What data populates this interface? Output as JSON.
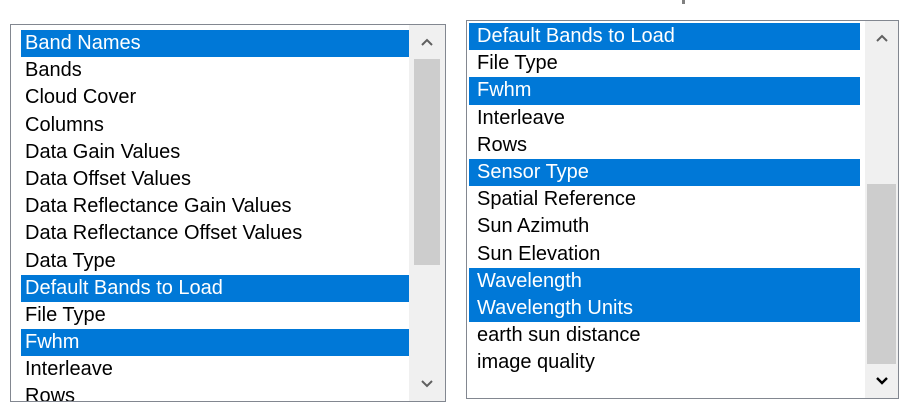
{
  "left_list": {
    "items": [
      {
        "label": "Band Names",
        "selected": true
      },
      {
        "label": "Bands",
        "selected": false
      },
      {
        "label": "Cloud Cover",
        "selected": false
      },
      {
        "label": "Columns",
        "selected": false
      },
      {
        "label": "Data Gain Values",
        "selected": false
      },
      {
        "label": "Data Offset Values",
        "selected": false
      },
      {
        "label": "Data Reflectance Gain Values",
        "selected": false
      },
      {
        "label": "Data Reflectance Offset Values",
        "selected": false
      },
      {
        "label": "Data Type",
        "selected": false
      },
      {
        "label": "Default Bands to Load",
        "selected": true
      },
      {
        "label": "File Type",
        "selected": false
      },
      {
        "label": "Fwhm",
        "selected": true
      },
      {
        "label": "Interleave",
        "selected": false
      },
      {
        "label": "Rows",
        "selected": false
      }
    ]
  },
  "right_list": {
    "items": [
      {
        "label": "Default Bands to Load",
        "selected": true
      },
      {
        "label": "File Type",
        "selected": false
      },
      {
        "label": "Fwhm",
        "selected": true
      },
      {
        "label": "Interleave",
        "selected": false
      },
      {
        "label": "Rows",
        "selected": false
      },
      {
        "label": "Sensor Type",
        "selected": true
      },
      {
        "label": "Spatial Reference",
        "selected": false
      },
      {
        "label": "Sun Azimuth",
        "selected": false
      },
      {
        "label": "Sun Elevation",
        "selected": false
      },
      {
        "label": "Wavelength",
        "selected": true
      },
      {
        "label": "Wavelength Units",
        "selected": true
      },
      {
        "label": "earth sun distance",
        "selected": false
      },
      {
        "label": "image quality",
        "selected": false
      }
    ]
  },
  "icons": {
    "scroll_up": "chevron-up-icon",
    "scroll_down": "chevron-down-icon"
  },
  "colors": {
    "selection": "#0078d7",
    "scroll_thumb": "#cdcdcd",
    "scroll_track": "#f0f0f0"
  }
}
